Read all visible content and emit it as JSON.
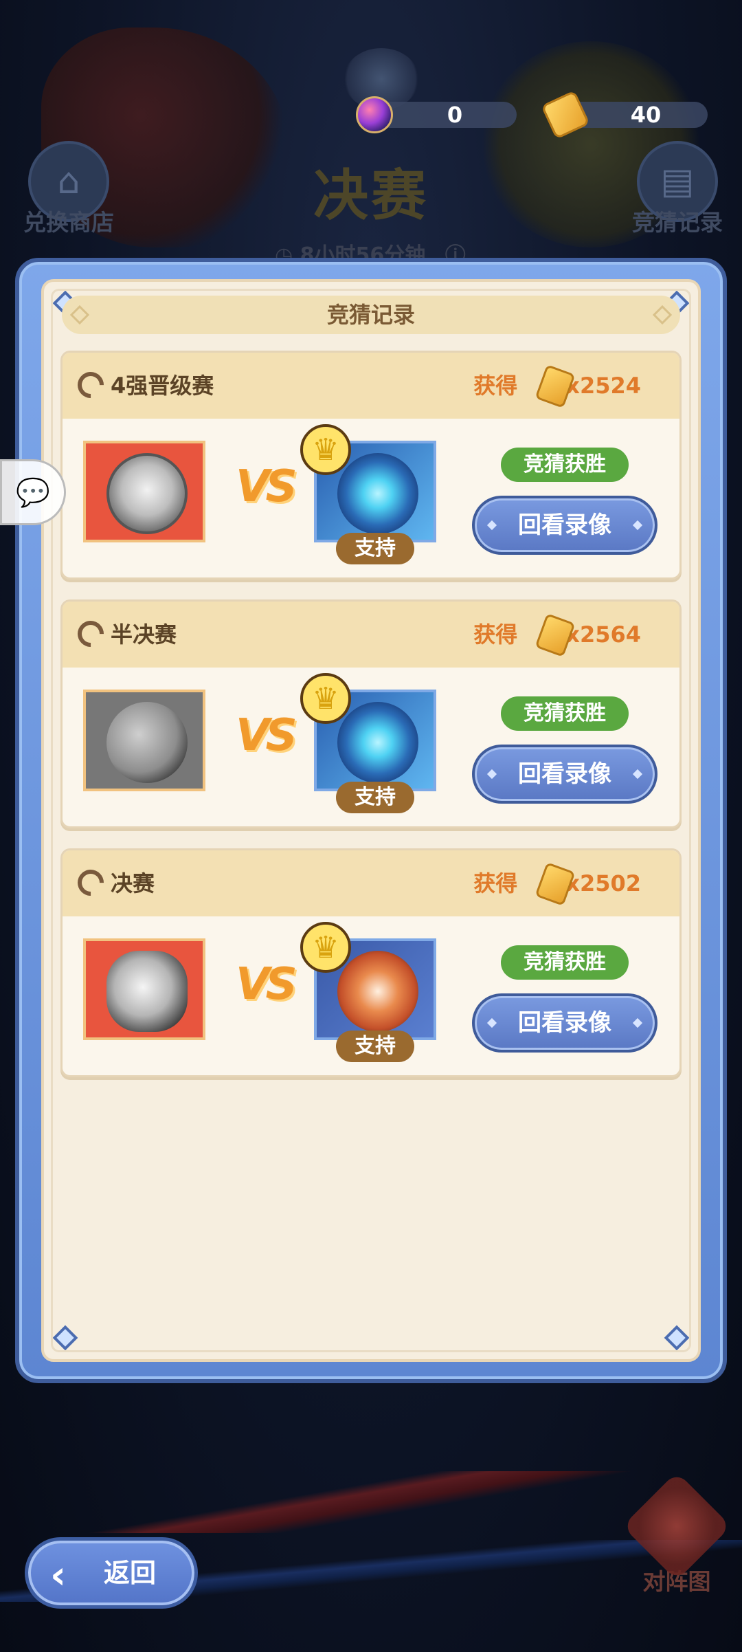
{
  "top_bar": {
    "gem_count": "0",
    "ticket_count": "40",
    "stage_title": "决赛",
    "timer": "8小时56分钟"
  },
  "side_buttons": {
    "exchange_shop": "兑换商店",
    "guess_record": "竞猜记录"
  },
  "dialog": {
    "title": "竞猜记录",
    "gain_label": "获得",
    "support_label": "支持",
    "win_badge": "竞猜获胜",
    "replay_label": "回看录像",
    "vs_text": "VS",
    "records": [
      {
        "round": "4强晋级赛",
        "reward": "x2524"
      },
      {
        "round": "半决赛",
        "reward": "x2564"
      },
      {
        "round": "决赛",
        "reward": "x2502"
      }
    ]
  },
  "bottom": {
    "back_label": "返回",
    "lineup_label": "对阵图"
  },
  "colors": {
    "panel_blue": "#6f92e0",
    "win_green": "#5aa840",
    "reward_orange": "#e07a2a",
    "support_brown": "#9a6a2f"
  },
  "icons": [
    "gem-icon",
    "ticket-icon",
    "shop-icon",
    "record-icon",
    "info-icon",
    "moon-icon",
    "crown-icon",
    "chat-icon",
    "back-arrow-icon",
    "crossed-swords-icon"
  ]
}
